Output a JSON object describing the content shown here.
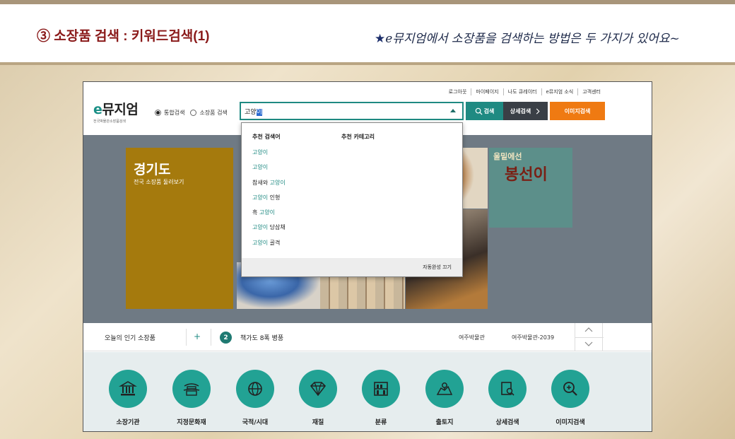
{
  "slide": {
    "title": "③ 소장품 검색 : 키워드검색(1)",
    "note_star": "★",
    "note": "e뮤지엄에서 소장품을 검색하는 방법은 두 가지가 있어요~"
  },
  "header": {
    "util_nav": [
      "로그아웃",
      "마이페이지",
      "나도 큐레이터",
      "e뮤지엄 소식",
      "고객센터"
    ],
    "logo_e": "e",
    "logo_rest": "뮤지엄",
    "logo_sub": "전국박물관소장품검색",
    "radio_all": "통합검색",
    "radio_collection": "소장품 검색",
    "search_prefix": "고양",
    "search_selected": "이",
    "btn_search": "검색",
    "btn_detail": "상세검색",
    "btn_image": "이미지검색"
  },
  "hero": {
    "title": "경기도",
    "subtitle": "전국 소장품 둘러보기",
    "poster_top": "울밑에선",
    "poster_title": "봉선이"
  },
  "dropdown": {
    "head_suggest": "추천 검색어",
    "head_category": "추천 카테고리",
    "items": [
      {
        "pre": "",
        "hl": "고양이",
        "post": ""
      },
      {
        "pre": "",
        "hl": "고양이",
        "post": ""
      },
      {
        "pre": "참새와 ",
        "hl": "고양이",
        "post": ""
      },
      {
        "pre": "",
        "hl": "고양이",
        "post": " 인형"
      },
      {
        "pre": "흑 ",
        "hl": "고양이",
        "post": ""
      },
      {
        "pre": "",
        "hl": "고양이",
        "post": " 당삼채"
      },
      {
        "pre": "",
        "hl": "고양이",
        "post": " 골격"
      }
    ],
    "footer": "자동완성 끄기"
  },
  "ticker": {
    "label": "오늘의 인기 소장품",
    "plus": "+",
    "rank": "2",
    "title": "책가도 8폭 병풍",
    "org": "여주박물관",
    "code": "여주박물관-2039"
  },
  "categories": [
    "소장기관",
    "지정문화재",
    "국적/시대",
    "재질",
    "분류",
    "출토지",
    "상세검색",
    "이미지검색"
  ],
  "colors": {
    "teal": "#1f8a82",
    "orange": "#ef7a12",
    "gold": "#a57a0d",
    "dark": "#3a3f46"
  }
}
